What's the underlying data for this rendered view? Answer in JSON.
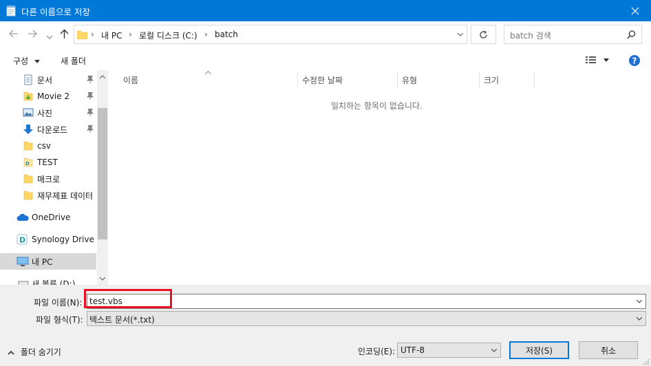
{
  "window": {
    "title": "다른 이름으로 저장"
  },
  "address": {
    "segments": [
      "내 PC",
      "로컬 디스크 (C:)",
      "batch"
    ]
  },
  "search": {
    "placeholder": "batch 검색"
  },
  "toolbar": {
    "organize": "구성",
    "new_folder": "새 폴더"
  },
  "nav": {
    "items": [
      {
        "label": "문서",
        "icon": "documents-icon",
        "pinned": true
      },
      {
        "label": "Movie 2",
        "icon": "folder-download-icon",
        "pinned": true
      },
      {
        "label": "사진",
        "icon": "pictures-icon",
        "pinned": true
      },
      {
        "label": "다운로드",
        "icon": "download-arrow-icon",
        "pinned": true
      },
      {
        "label": "csv",
        "icon": "folder-icon",
        "pinned": false
      },
      {
        "label": "TEST",
        "icon": "synology-folder-icon",
        "pinned": false
      },
      {
        "label": "매크로",
        "icon": "folder-icon",
        "pinned": false
      },
      {
        "label": "재무제표 데이터",
        "icon": "folder-icon",
        "pinned": false
      },
      {
        "label": "OneDrive",
        "icon": "onedrive-cloud-icon",
        "pinned": false
      },
      {
        "label": "Synology Drive -",
        "icon": "synology-drive-icon",
        "pinned": false
      },
      {
        "label": "내 PC",
        "icon": "this-pc-icon",
        "pinned": false
      },
      {
        "label": "새 볼륨 (D:)",
        "icon": "drive-icon",
        "pinned": false
      }
    ]
  },
  "columns": {
    "name": "이름",
    "modified": "수정한 날짜",
    "type": "유형",
    "size": "크기"
  },
  "empty_message": "일치하는 항목이 없습니다.",
  "form": {
    "filename_label": "파일 이름(N):",
    "filename_value": "test.vbs",
    "filetype_label": "파일 형식(T):",
    "filetype_value": "텍스트 문서(*.txt)",
    "encoding_label": "인코딩(E):",
    "encoding_value": "UTF-8"
  },
  "buttons": {
    "hide_folders": "폴더 숨기기",
    "save": "저장(S)",
    "cancel": "취소"
  },
  "colors": {
    "titlebar": "#0078d7",
    "highlight_box": "#e81123",
    "selected_nav": "#cce8ff"
  }
}
